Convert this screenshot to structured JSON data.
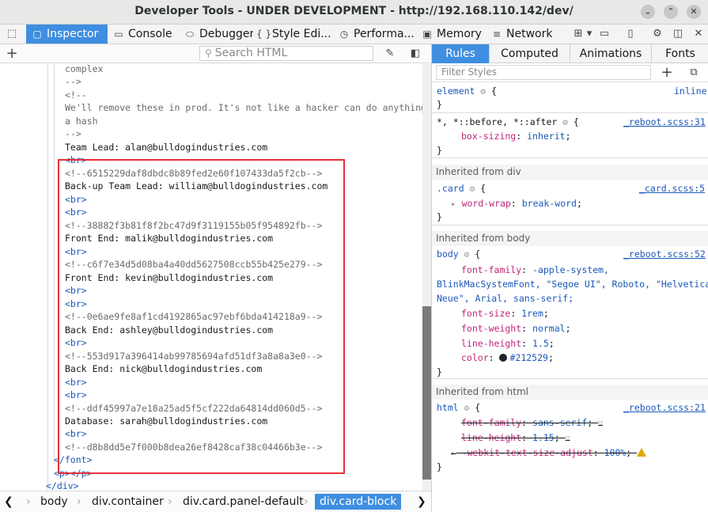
{
  "window": {
    "title": "Developer Tools - UNDER DEVELOPMENT - http://192.168.110.142/dev/",
    "minimize_glyph": "⌄",
    "maximize_glyph": "⌃",
    "close_glyph": "✕"
  },
  "toolbar": {
    "pick_glyph": "⬚",
    "tabs": [
      {
        "label": "Inspector",
        "icon": "inspector-icon",
        "glyph": "▢"
      },
      {
        "label": "Console",
        "icon": "console-icon",
        "glyph": "▭"
      },
      {
        "label": "Debugger",
        "icon": "debugger-icon",
        "glyph": "⬭"
      },
      {
        "label": "Style Edi...",
        "icon": "braces-icon",
        "glyph": "{ }"
      },
      {
        "label": "Performa...",
        "icon": "performance-icon",
        "glyph": "◷"
      },
      {
        "label": "Memory",
        "icon": "memory-icon",
        "glyph": "▣"
      },
      {
        "label": "Network",
        "icon": "network-icon",
        "glyph": "≡"
      }
    ],
    "right_glyphs": [
      "⊞",
      "▾",
      "▭",
      "▯",
      "⚙",
      "◫",
      "✕"
    ]
  },
  "inspector": {
    "add_glyph": "+",
    "search_placeholder": "Search HTML",
    "search_glyph": "⚲",
    "eyedropper_glyph": "✎",
    "sidebar_toggle_glyph": "◧",
    "markup_lines": [
      "complex",
      "-->",
      "<!--",
      "We'll remove these in prod. It's not like a hacker can do anything with",
      "a hash",
      "-->",
      "Team Lead: alan@bulldogindustries.com",
      "<br>",
      "<!--6515229daf8dbdc8b89fed2e60f107433da5f2cb-->",
      "Back-up Team Lead: william@bulldogindustries.com",
      "<br>",
      "<br>",
      "<!--38882f3b81f8f2bc47d9f3119155b05f954892fb-->",
      "Front End: malik@bulldogindustries.com",
      "<br>",
      "<!--c6f7e34d5d08ba4a40dd5627508ccb55b425e279-->",
      "Front End: kevin@bulldogindustries.com",
      "<br>",
      "<br>",
      "<!--0e6ae9fe8af1cd4192865ac97ebf6bda414218a9-->",
      "Back End: ashley@bulldogindustries.com",
      "<br>",
      "<!--553d917a396414ab99785694afd51df3a8a8a3e0-->",
      "Back End: nick@bulldogindustries.com",
      "<br>",
      "<br>",
      "<!--ddf45997a7e18a25ad5f5cf222da64814dd060d5-->",
      "Database: sarah@bulldogindustries.com",
      "<br>",
      "<!--d8b8dd5e7f000b8dea26ef8428caf38c04466b3e-->",
      "</font>",
      "<p></p>",
      "</div>"
    ],
    "breadcrumbs": [
      "body",
      "div.container",
      "div.card.panel-default",
      "div.card-block"
    ],
    "crumb_left_glyph": "❮",
    "crumb_right_glyph": "❯",
    "crumb_sep_glyph": "›"
  },
  "rules_panel": {
    "tabs": [
      "Rules",
      "Computed",
      "Animations",
      "Fonts"
    ],
    "filter_placeholder": "Filter Styles",
    "add_rule_glyph": "+",
    "toggle_pseudo_glyph": "⧉",
    "gear_glyph": "⚙",
    "funnel_glyph": "▽",
    "expand_glyph": "▸",
    "open_brace": "{",
    "close_brace": "}",
    "element_rule": {
      "selector": "element",
      "source": "inline"
    },
    "reboot_universal": {
      "selector": "*, *::before, *::after",
      "source": "_reboot.scss:31",
      "prop": "box-sizing",
      "value": "inherit"
    },
    "inherited_div": "Inherited from div",
    "card_rule": {
      "selector": ".card",
      "source": "_card.scss:5",
      "prop": "word-wrap",
      "value": "break-word"
    },
    "inherited_body": "Inherited from body",
    "body_rule": {
      "selector": "body",
      "source": "_reboot.scss:52",
      "font_family_prop": "font-family",
      "font_family_value_1": "-apple-system,",
      "font_family_value_2": "BlinkMacSystemFont, \"Segoe UI\", Roboto, \"Helvetica",
      "font_family_value_3": "Neue\", Arial, sans-serif;",
      "font_size_prop": "font-size",
      "font_size_value": "1rem",
      "font_weight_prop": "font-weight",
      "font_weight_value": "normal",
      "line_height_prop": "line-height",
      "line_height_value": "1.5",
      "color_prop": "color",
      "color_value": "#212529"
    },
    "inherited_html": "Inherited from html",
    "html_rule": {
      "selector": "html",
      "source": "_reboot.scss:21",
      "font_family_prop": "font-family",
      "font_family_value": "sans-serif",
      "line_height_prop": "line-height",
      "line_height_value": "1.15",
      "text_size_prop": "-webkit-text-size-adjust",
      "text_size_value": "100%"
    }
  },
  "colors": {
    "accent": "#3f8ee0",
    "highlight_box": "#e8303a",
    "css_property": "#c02678",
    "css_value": "#1c58b8",
    "swatch": "#212529",
    "warning": "#e0a800"
  }
}
